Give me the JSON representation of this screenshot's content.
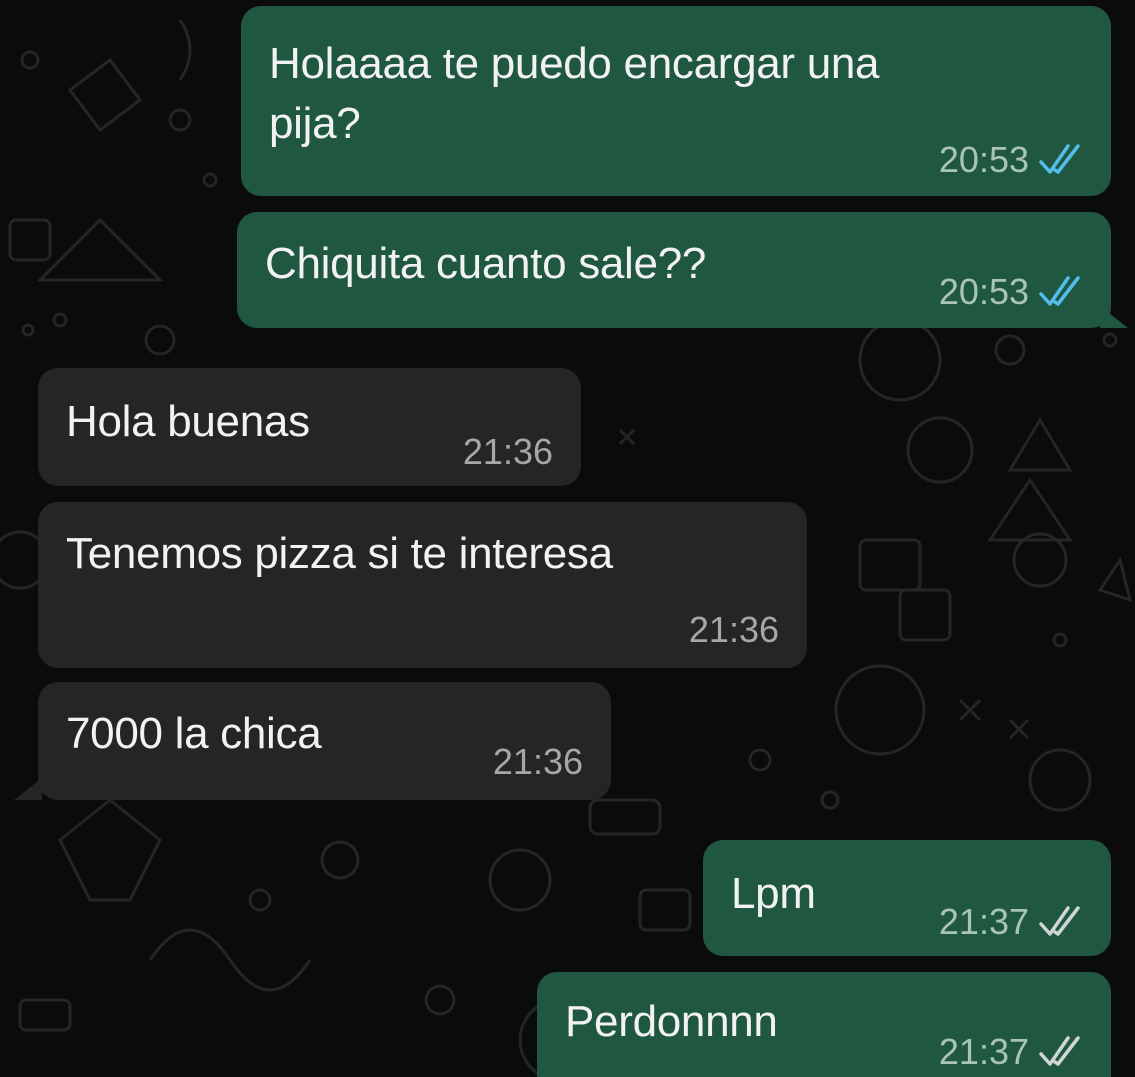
{
  "colors": {
    "background": "#0b0b0b",
    "outgoing_bubble": "#1f5741",
    "incoming_bubble": "#242626",
    "read_tick": "#53bdeb",
    "delivered_tick": "#d0d6d3"
  },
  "messages": [
    {
      "direction": "outgoing",
      "text": "Holaaaa te puedo encargar una\npija?",
      "time": "20:53",
      "status": "read",
      "status_icon": "double-check-icon"
    },
    {
      "direction": "outgoing",
      "text": "Chiquita cuanto sale??",
      "time": "20:53",
      "status": "read",
      "status_icon": "double-check-icon"
    },
    {
      "direction": "incoming",
      "text": "Hola buenas",
      "time": "21:36"
    },
    {
      "direction": "incoming",
      "text": "Tenemos pizza si te interesa",
      "time": "21:36"
    },
    {
      "direction": "incoming",
      "text": "7000 la chica",
      "time": "21:36"
    },
    {
      "direction": "outgoing",
      "text": "Lpm",
      "time": "21:37",
      "status": "delivered",
      "status_icon": "double-check-icon"
    },
    {
      "direction": "outgoing",
      "text": "Perdonnnn",
      "time": "21:37",
      "status": "delivered",
      "status_icon": "double-check-icon"
    }
  ]
}
